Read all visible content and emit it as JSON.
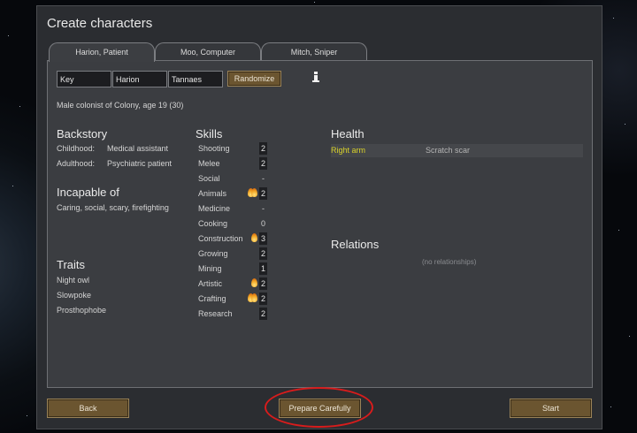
{
  "window": {
    "title": "Create characters"
  },
  "tabs": [
    {
      "label": "Harion, Patient",
      "active": true
    },
    {
      "label": "Moo, Computer",
      "active": false
    },
    {
      "label": "Mitch, Sniper",
      "active": false
    }
  ],
  "name_fields": {
    "first": "Key",
    "nick": "Harion",
    "last": "Tannaes"
  },
  "randomize_label": "Randomize",
  "info_icon": "info-icon",
  "description": "Male colonist of Colony, age 19 (30)",
  "backstory": {
    "heading": "Backstory",
    "childhood_label": "Childhood:",
    "childhood_value": "Medical assistant",
    "adulthood_label": "Adulthood:",
    "adulthood_value": "Psychiatric patient"
  },
  "incapable": {
    "heading": "Incapable of",
    "text": "Caring, social, scary, firefighting"
  },
  "traits": {
    "heading": "Traits",
    "items": [
      "Night owl",
      "Slowpoke",
      "Prosthophobe"
    ]
  },
  "skills": {
    "heading": "Skills",
    "items": [
      {
        "name": "Shooting",
        "level": "2",
        "passion": 0
      },
      {
        "name": "Melee",
        "level": "2",
        "passion": 0
      },
      {
        "name": "Social",
        "level": "-",
        "passion": 0
      },
      {
        "name": "Animals",
        "level": "2",
        "passion": 2
      },
      {
        "name": "Medicine",
        "level": "-",
        "passion": 0
      },
      {
        "name": "Cooking",
        "level": "0",
        "passion": 0
      },
      {
        "name": "Construction",
        "level": "3",
        "passion": 1
      },
      {
        "name": "Growing",
        "level": "2",
        "passion": 0
      },
      {
        "name": "Mining",
        "level": "1",
        "passion": 0
      },
      {
        "name": "Artistic",
        "level": "2",
        "passion": 1
      },
      {
        "name": "Crafting",
        "level": "2",
        "passion": 2
      },
      {
        "name": "Research",
        "level": "2",
        "passion": 0
      }
    ]
  },
  "health": {
    "heading": "Health",
    "rows": [
      {
        "part": "Right arm",
        "condition": "Scratch scar"
      }
    ]
  },
  "relations": {
    "heading": "Relations",
    "empty_text": "(no relationships)"
  },
  "buttons": {
    "back": "Back",
    "prepare": "Prepare Carefully",
    "start": "Start"
  },
  "colors": {
    "panel": "#3b3d41",
    "button": "#6b5530",
    "health_highlight": "#d9d22a",
    "annotation_circle": "#d81c1c"
  }
}
